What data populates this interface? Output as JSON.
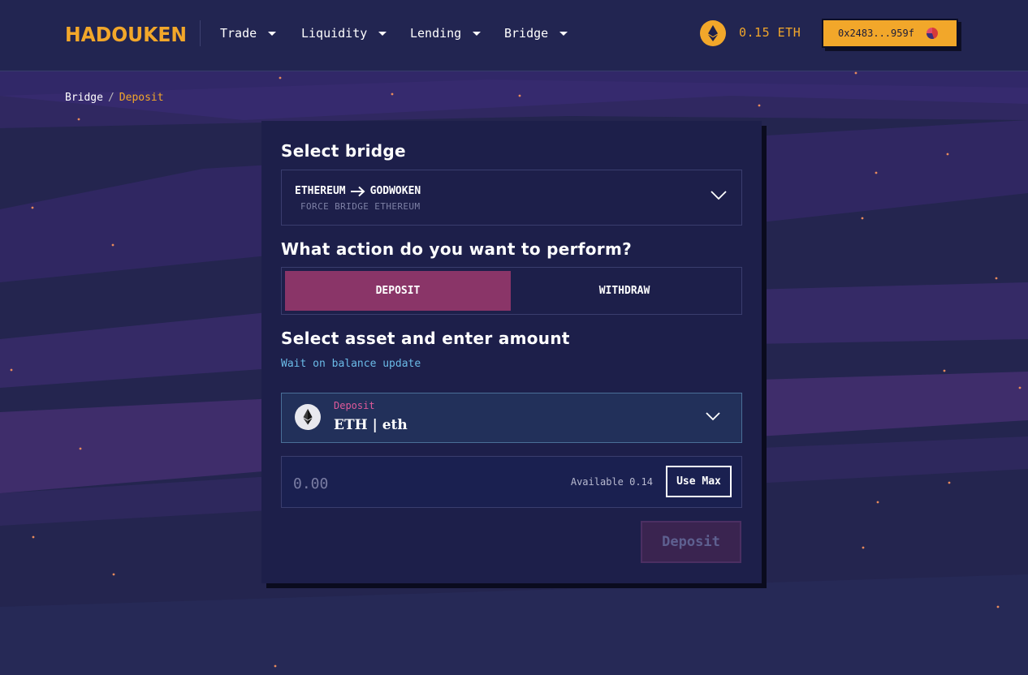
{
  "header": {
    "logo_text": "HADOUKEN",
    "nav": [
      {
        "label": "Trade"
      },
      {
        "label": "Liquidity"
      },
      {
        "label": "Lending"
      },
      {
        "label": "Bridge"
      }
    ],
    "eth_balance": "0.15 ETH",
    "wallet_address": "0x2483...959f"
  },
  "breadcrumb": {
    "parent": "Bridge",
    "separator": "/",
    "current": "Deposit"
  },
  "card": {
    "select_bridge_title": "Select bridge",
    "bridge": {
      "from": "ETHEREUM",
      "to": "GODWOKEN",
      "subtitle": "FORCE BRIDGE ETHEREUM"
    },
    "action_title": "What action do you want to perform?",
    "actions": [
      {
        "label": "DEPOSIT",
        "active": true
      },
      {
        "label": "WITHDRAW",
        "active": false
      }
    ],
    "asset_title": "Select asset and enter amount",
    "wait_text": "Wait on balance update",
    "asset": {
      "label": "Deposit",
      "name": "ETH | eth"
    },
    "amount": {
      "placeholder": "0.00",
      "available": "Available 0.14",
      "use_max": "Use Max"
    },
    "submit_label": "Deposit"
  },
  "colors": {
    "background": "#24254f",
    "accent": "#f2a72a",
    "active_tab": "#8a3568",
    "link": "#6bbbe8"
  }
}
